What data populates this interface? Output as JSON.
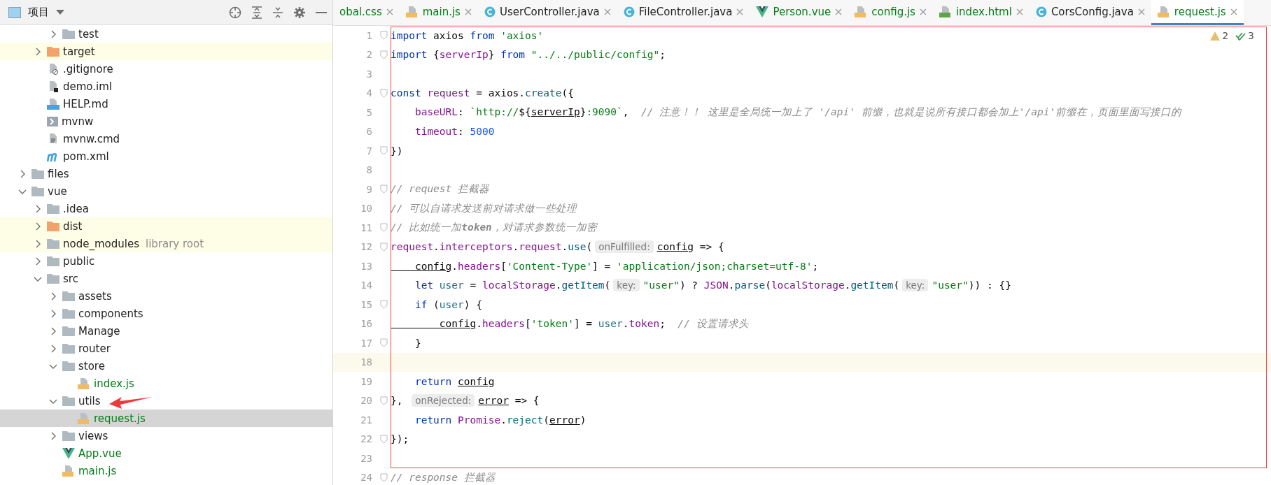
{
  "project_panel": {
    "title": "项目"
  },
  "tree": [
    {
      "children": [
        {
          "children": [
            {
              "label": "test",
              "kind": "folder",
              "expanded": false,
              "selected": false,
              "excluded": false,
              "vcs_added": false
            }
          ]
        },
        {
          "label": "target",
          "kind": "folder-excluded",
          "expanded": false,
          "selected": false,
          "excluded": true,
          "vcs_added": false
        },
        {
          "label": ".gitignore",
          "kind": "ignore-file",
          "selected": false,
          "excluded": false,
          "vcs_added": false
        },
        {
          "label": "demo.iml",
          "kind": "module-file",
          "selected": false,
          "excluded": false,
          "vcs_added": false
        },
        {
          "label": "HELP.md",
          "kind": "markdown-file",
          "selected": false,
          "excluded": false,
          "vcs_added": false
        },
        {
          "label": "mvnw",
          "kind": "shell-file",
          "selected": false,
          "excluded": false,
          "vcs_added": false
        },
        {
          "label": "mvnw.cmd",
          "kind": "text-file",
          "selected": false,
          "excluded": false,
          "vcs_added": false
        },
        {
          "label": "pom.xml",
          "kind": "maven-file",
          "selected": false,
          "excluded": false,
          "vcs_added": false
        }
      ]
    },
    {
      "label": "files",
      "kind": "folder",
      "expanded": false,
      "selected": false,
      "excluded": false,
      "vcs_added": false
    },
    {
      "label": "vue",
      "kind": "folder",
      "expanded": true,
      "selected": false,
      "excluded": false,
      "vcs_added": false,
      "children": [
        {
          "label": ".idea",
          "kind": "folder",
          "expanded": false,
          "selected": false,
          "excluded": false,
          "vcs_added": false
        },
        {
          "label": "dist",
          "kind": "folder-excluded",
          "expanded": false,
          "selected": false,
          "excluded": true,
          "vcs_added": false
        },
        {
          "label": "node_modules",
          "note": "library root",
          "kind": "folder",
          "expanded": false,
          "selected": false,
          "excluded": true,
          "vcs_added": false
        },
        {
          "label": "public",
          "kind": "folder",
          "expanded": false,
          "selected": false,
          "excluded": false,
          "vcs_added": false
        },
        {
          "label": "src",
          "kind": "folder",
          "expanded": true,
          "selected": false,
          "excluded": false,
          "vcs_added": false,
          "children": [
            {
              "label": "assets",
              "kind": "folder",
              "expanded": false,
              "selected": false,
              "excluded": false,
              "vcs_added": false
            },
            {
              "label": "components",
              "kind": "folder",
              "expanded": false,
              "selected": false,
              "excluded": false,
              "vcs_added": false
            },
            {
              "label": "Manage",
              "kind": "folder",
              "expanded": false,
              "selected": false,
              "excluded": false,
              "vcs_added": false
            },
            {
              "label": "router",
              "kind": "folder",
              "expanded": false,
              "selected": false,
              "excluded": false,
              "vcs_added": false
            },
            {
              "label": "store",
              "kind": "folder",
              "expanded": true,
              "selected": false,
              "excluded": false,
              "vcs_added": false,
              "children": [
                {
                  "label": "index.js",
                  "kind": "js-file",
                  "selected": false,
                  "excluded": false,
                  "vcs_added": true
                }
              ]
            },
            {
              "label": "utils",
              "kind": "folder",
              "expanded": true,
              "selected": false,
              "excluded": false,
              "vcs_added": false,
              "children": [
                {
                  "label": "request.js",
                  "kind": "js-file",
                  "selected": true,
                  "excluded": false,
                  "vcs_added": true
                }
              ]
            },
            {
              "label": "views",
              "kind": "folder",
              "expanded": false,
              "selected": false,
              "excluded": false,
              "vcs_added": false
            },
            {
              "label": "App.vue",
              "kind": "vue-file",
              "selected": false,
              "excluded": false,
              "vcs_added": true
            },
            {
              "label": "main.js",
              "kind": "js-file",
              "selected": false,
              "excluded": false,
              "vcs_added": true
            }
          ]
        }
      ]
    }
  ],
  "tabs": [
    {
      "label": "obal.css",
      "kind": "cut",
      "selected": false,
      "vcs_added": true
    },
    {
      "label": "main.js",
      "kind": "js-file",
      "selected": false,
      "vcs_added": true
    },
    {
      "label": "UserController.java",
      "kind": "java-class",
      "selected": false,
      "vcs_added": false
    },
    {
      "label": "FileController.java",
      "kind": "java-class",
      "selected": false,
      "vcs_added": false
    },
    {
      "label": "Person.vue",
      "kind": "vue-file",
      "selected": false,
      "vcs_added": true
    },
    {
      "label": "config.js",
      "kind": "js-file",
      "selected": false,
      "vcs_added": true
    },
    {
      "label": "index.html",
      "kind": "html-file",
      "selected": false,
      "vcs_added": true
    },
    {
      "label": "CorsConfig.java",
      "kind": "java-class",
      "selected": false,
      "vcs_added": false
    },
    {
      "label": "request.js",
      "kind": "js-file",
      "selected": true,
      "vcs_added": true
    }
  ],
  "inspections": {
    "warnings": "2",
    "passed": "3"
  },
  "code_lines": [
    {
      "number": "1",
      "fold": true,
      "current": false,
      "tokens": [
        {
          "text": "import ",
          "kind": "keyword"
        },
        {
          "text": "axios ",
          "kind": "plain"
        },
        {
          "text": "from ",
          "kind": "keyword"
        },
        {
          "text": "'axios'",
          "kind": "string"
        }
      ]
    },
    {
      "number": "2",
      "fold": true,
      "current": false,
      "tokens": [
        {
          "text": "import ",
          "kind": "keyword"
        },
        {
          "text": "{",
          "kind": "plain"
        },
        {
          "text": "serverIp",
          "kind": "field"
        },
        {
          "text": "} ",
          "kind": "plain"
        },
        {
          "text": "from ",
          "kind": "keyword"
        },
        {
          "text": "\"../../public/config\"",
          "kind": "string"
        },
        {
          "text": ";",
          "kind": "plain"
        }
      ]
    },
    {
      "number": "3",
      "fold": false,
      "current": false
    },
    {
      "number": "4",
      "fold": true,
      "current": false,
      "tokens": [
        {
          "text": "const ",
          "kind": "keyword"
        },
        {
          "text": "request",
          "kind": "field"
        },
        {
          "text": " = axios.",
          "kind": "plain"
        },
        {
          "text": "create",
          "kind": "function"
        },
        {
          "text": "({",
          "kind": "plain"
        }
      ]
    },
    {
      "number": "5",
      "fold": false,
      "current": false,
      "tokens": [
        {
          "text": "    baseURL",
          "kind": "field"
        },
        {
          "text": ": ",
          "kind": "plain"
        },
        {
          "text": "`http://",
          "kind": "string"
        },
        {
          "text": "${",
          "kind": "plain"
        },
        {
          "text": "serverIp",
          "kind": "parameter"
        },
        {
          "text": "}",
          "kind": "plain"
        },
        {
          "text": ":9090`",
          "kind": "string"
        },
        {
          "text": ",  ",
          "kind": "plain"
        },
        {
          "text": "// 注意！！ 这里是全局统一加上了 '/api' 前缀，也就是说所有接口都会加上'/api'前缀在，页面里面写接口的",
          "kind": "comment"
        }
      ]
    },
    {
      "number": "6",
      "fold": false,
      "current": false,
      "tokens": [
        {
          "text": "    timeout",
          "kind": "field"
        },
        {
          "text": ": ",
          "kind": "plain"
        },
        {
          "text": "5000",
          "kind": "number"
        }
      ]
    },
    {
      "number": "7",
      "fold": true,
      "current": false,
      "tokens": [
        {
          "text": "})",
          "kind": "plain"
        }
      ]
    },
    {
      "number": "8",
      "fold": false,
      "current": false
    },
    {
      "number": "9",
      "fold": true,
      "current": false,
      "tokens": [
        {
          "text": "// request 拦截器",
          "kind": "comment"
        }
      ]
    },
    {
      "number": "10",
      "fold": false,
      "current": false,
      "tokens": [
        {
          "text": "// 可以自请求发送前对请求做一些处理",
          "kind": "comment"
        }
      ]
    },
    {
      "number": "11",
      "fold": true,
      "current": false,
      "tokens": [
        {
          "text": "// 比如统一加**token**，对请求参数统一加密",
          "kind": "comment"
        }
      ]
    },
    {
      "number": "12",
      "fold": true,
      "current": false,
      "tokens": [
        {
          "text": "request",
          "kind": "field"
        },
        {
          "text": ".",
          "kind": "plain"
        },
        {
          "text": "interceptors",
          "kind": "field"
        },
        {
          "text": ".",
          "kind": "plain"
        },
        {
          "text": "request",
          "kind": "field"
        },
        {
          "text": ".",
          "kind": "plain"
        },
        {
          "text": "use",
          "kind": "function"
        },
        {
          "text": "(",
          "kind": "plain"
        },
        {
          "text": "onFulfilled:",
          "kind": "hint"
        },
        {
          "text": "config",
          "kind": "parameter"
        },
        {
          "text": " => {",
          "kind": "plain"
        }
      ]
    },
    {
      "number": "13",
      "fold": false,
      "current": false,
      "tokens": [
        {
          "text": "    config",
          "kind": "parameter"
        },
        {
          "text": ".",
          "kind": "plain"
        },
        {
          "text": "headers",
          "kind": "field"
        },
        {
          "text": "[",
          "kind": "plain"
        },
        {
          "text": "'Content-Type'",
          "kind": "string"
        },
        {
          "text": "] = ",
          "kind": "plain"
        },
        {
          "text": "'application/json;charset=utf-8'",
          "kind": "string"
        },
        {
          "text": ";",
          "kind": "plain"
        }
      ]
    },
    {
      "number": "14",
      "fold": false,
      "current": false,
      "tokens": [
        {
          "text": "    let ",
          "kind": "keyword"
        },
        {
          "text": "user",
          "kind": "local"
        },
        {
          "text": " = ",
          "kind": "plain"
        },
        {
          "text": "localStorage",
          "kind": "field"
        },
        {
          "text": ".",
          "kind": "plain"
        },
        {
          "text": "getItem",
          "kind": "function"
        },
        {
          "text": "(",
          "kind": "plain"
        },
        {
          "text": "key:",
          "kind": "hint"
        },
        {
          "text": "\"user\"",
          "kind": "string"
        },
        {
          "text": ") ? ",
          "kind": "plain"
        },
        {
          "text": "JSON",
          "kind": "field"
        },
        {
          "text": ".",
          "kind": "plain"
        },
        {
          "text": "parse",
          "kind": "function"
        },
        {
          "text": "(",
          "kind": "plain"
        },
        {
          "text": "localStorage",
          "kind": "field"
        },
        {
          "text": ".",
          "kind": "plain"
        },
        {
          "text": "getItem",
          "kind": "function"
        },
        {
          "text": "(",
          "kind": "plain"
        },
        {
          "text": "key:",
          "kind": "hint"
        },
        {
          "text": "\"user\"",
          "kind": "string"
        },
        {
          "text": ")) : {}",
          "kind": "plain"
        }
      ]
    },
    {
      "number": "15",
      "fold": true,
      "current": false,
      "tokens": [
        {
          "text": "    if ",
          "kind": "keyword"
        },
        {
          "text": "(",
          "kind": "plain"
        },
        {
          "text": "user",
          "kind": "local"
        },
        {
          "text": ") {",
          "kind": "plain"
        }
      ]
    },
    {
      "number": "16",
      "fold": false,
      "current": false,
      "tokens": [
        {
          "text": "        config",
          "kind": "parameter"
        },
        {
          "text": ".",
          "kind": "plain"
        },
        {
          "text": "headers",
          "kind": "field"
        },
        {
          "text": "[",
          "kind": "plain"
        },
        {
          "text": "'token'",
          "kind": "string"
        },
        {
          "text": "] = ",
          "kind": "plain"
        },
        {
          "text": "user",
          "kind": "local"
        },
        {
          "text": ".",
          "kind": "plain"
        },
        {
          "text": "token",
          "kind": "field"
        },
        {
          "text": ";  ",
          "kind": "plain"
        },
        {
          "text": "// 设置请求头",
          "kind": "comment"
        }
      ]
    },
    {
      "number": "17",
      "fold": true,
      "current": false,
      "tokens": [
        {
          "text": "    }",
          "kind": "plain"
        }
      ]
    },
    {
      "number": "18",
      "fold": false,
      "current": true
    },
    {
      "number": "19",
      "fold": false,
      "current": false,
      "tokens": [
        {
          "text": "    return ",
          "kind": "keyword"
        },
        {
          "text": "config",
          "kind": "parameter"
        }
      ]
    },
    {
      "number": "20",
      "fold": true,
      "current": false,
      "tokens": [
        {
          "text": "}, ",
          "kind": "plain"
        },
        {
          "text": "onRejected:",
          "kind": "hint"
        },
        {
          "text": "error",
          "kind": "parameter"
        },
        {
          "text": " => {",
          "kind": "plain"
        }
      ]
    },
    {
      "number": "21",
      "fold": false,
      "current": false,
      "tokens": [
        {
          "text": "    return ",
          "kind": "keyword"
        },
        {
          "text": "Promise",
          "kind": "field"
        },
        {
          "text": ".",
          "kind": "plain"
        },
        {
          "text": "reject",
          "kind": "function"
        },
        {
          "text": "(",
          "kind": "plain"
        },
        {
          "text": "error",
          "kind": "parameter"
        },
        {
          "text": ")",
          "kind": "plain"
        }
      ]
    },
    {
      "number": "22",
      "fold": true,
      "current": false,
      "tokens": [
        {
          "text": "});",
          "kind": "plain"
        }
      ]
    },
    {
      "number": "23",
      "fold": false,
      "current": false
    },
    {
      "number": "24",
      "fold": true,
      "current": false,
      "tokens": [
        {
          "text": "// response 拦截器",
          "kind": "comment"
        }
      ]
    }
  ]
}
